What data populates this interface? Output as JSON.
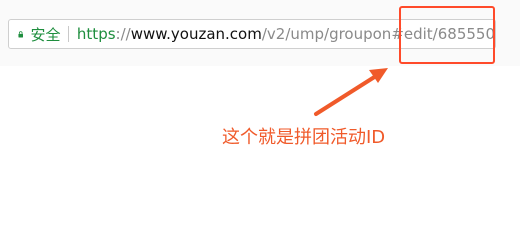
{
  "address_bar": {
    "secure_label": "安全",
    "scheme": "https",
    "separator": "://",
    "host": "www.youzan.com",
    "path": "/v2/ump/groupon#edit/685550"
  },
  "annotation": {
    "text": "这个就是拼团活动ID"
  },
  "colors": {
    "secure_green": "#1e8e3e",
    "highlight_red": "#ff4a2a",
    "annotation_orange": "#f05a2a"
  }
}
